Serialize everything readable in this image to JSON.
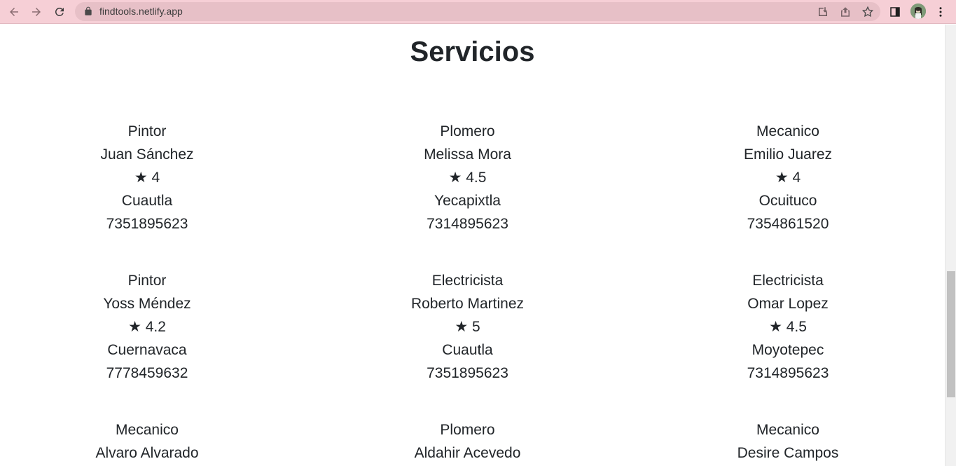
{
  "browser": {
    "url": "findtools.netlify.app",
    "icons": [
      "back-arrow-icon",
      "forward-arrow-icon",
      "reload-icon",
      "lock-icon",
      "install-icon",
      "share-icon",
      "star-icon",
      "side-panel-icon",
      "profile-avatar",
      "kebab-menu-icon"
    ],
    "toolbar_color": "#f6cfd6"
  },
  "page": {
    "title": "Servicios"
  },
  "services": [
    {
      "trade": "Pintor",
      "name": "Juan Sánchez",
      "rating": "★ 4",
      "city": "Cuautla",
      "phone": "7351895623"
    },
    {
      "trade": "Plomero",
      "name": "Melissa Mora",
      "rating": "★ 4.5",
      "city": "Yecapixtla",
      "phone": "7314895623"
    },
    {
      "trade": "Mecanico",
      "name": "Emilio Juarez",
      "rating": "★ 4",
      "city": "Ocuituco",
      "phone": "7354861520"
    },
    {
      "trade": "Pintor",
      "name": "Yoss Méndez",
      "rating": "★ 4.2",
      "city": "Cuernavaca",
      "phone": "7778459632"
    },
    {
      "trade": "Electricista",
      "name": "Roberto Martinez",
      "rating": "★ 5",
      "city": "Cuautla",
      "phone": "7351895623"
    },
    {
      "trade": "Electricista",
      "name": "Omar Lopez",
      "rating": "★ 4.5",
      "city": "Moyotepec",
      "phone": "7314895623"
    },
    {
      "trade": "Mecanico",
      "name": "Alvaro Alvarado",
      "rating": "",
      "city": "",
      "phone": ""
    },
    {
      "trade": "Plomero",
      "name": "Aldahir Acevedo",
      "rating": "",
      "city": "",
      "phone": ""
    },
    {
      "trade": "Mecanico",
      "name": "Desire Campos",
      "rating": "",
      "city": "",
      "phone": ""
    }
  ]
}
